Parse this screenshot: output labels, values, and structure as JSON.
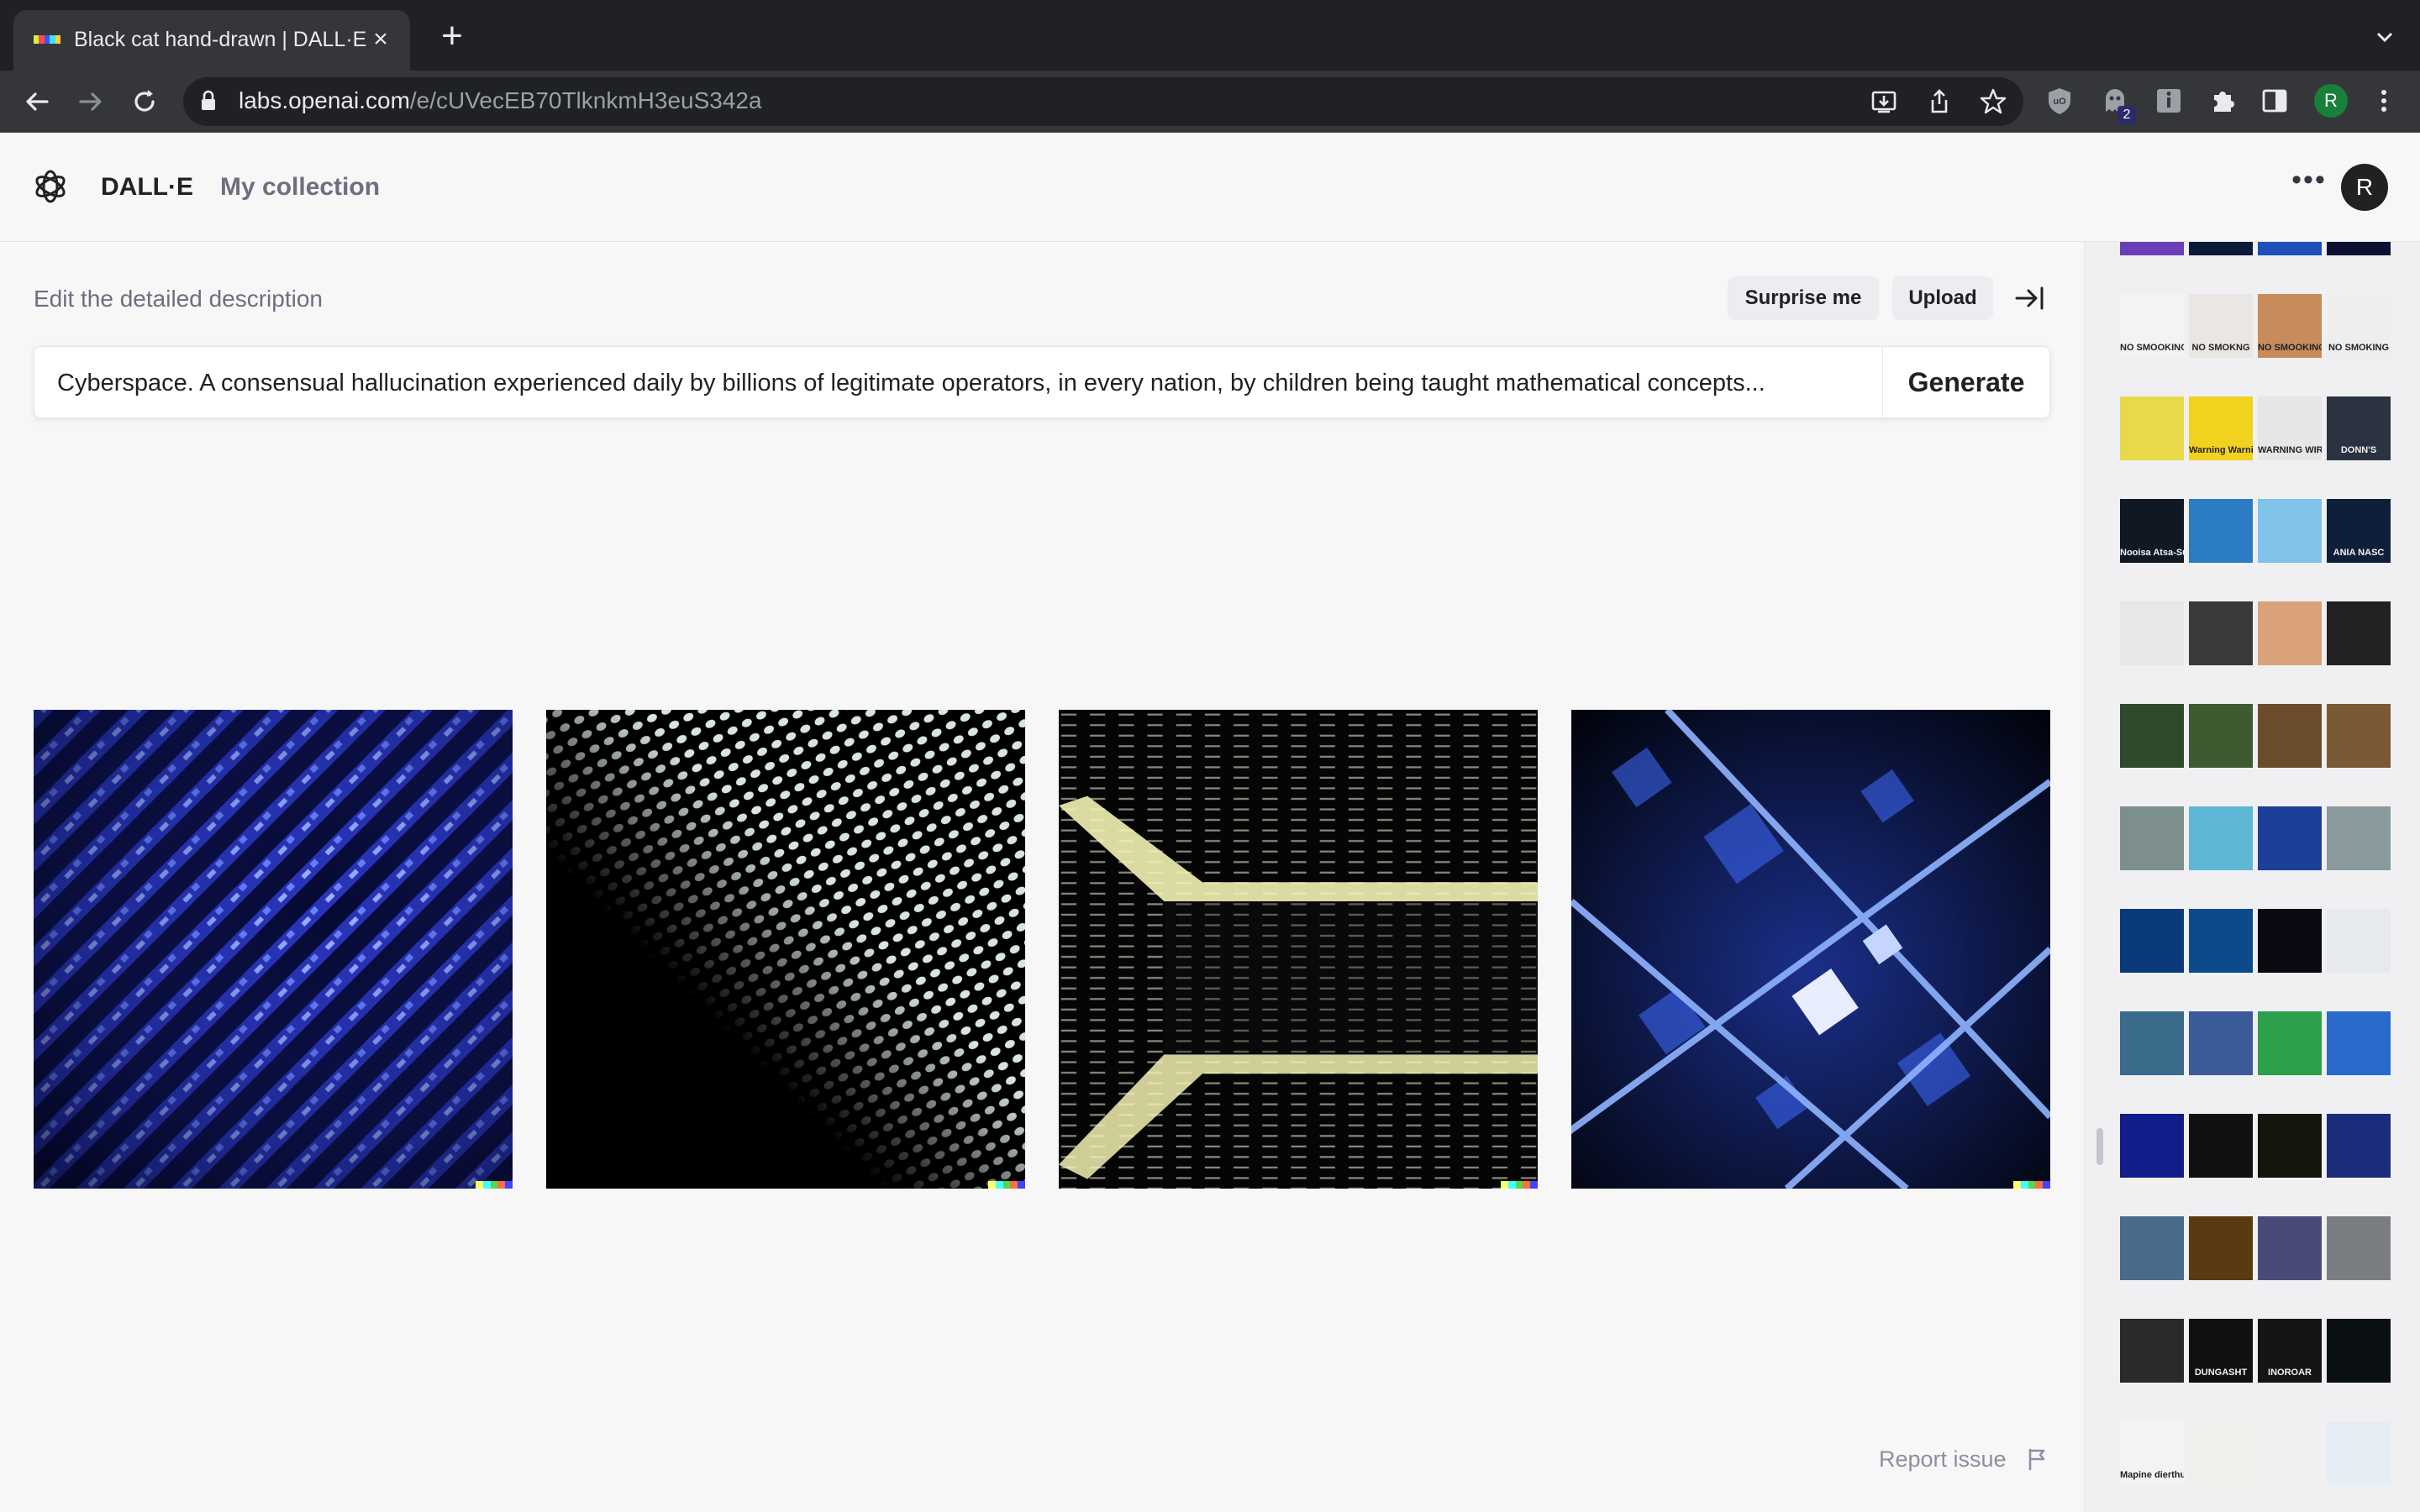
{
  "browser": {
    "tab_title": "Black cat hand-drawn | DALL·E",
    "url_host": "labs.openai.com",
    "url_path": "/e/cUVecEB70TlknkmH3euS342a",
    "profile_initial": "R",
    "extension_badge": "2",
    "favicon_colors": [
      "#d5f04a",
      "#ff4b4b",
      "#3f51ff",
      "#3ee3ff",
      "#ffcf3f"
    ]
  },
  "app": {
    "brand": "DALL·E",
    "nav_collection": "My collection",
    "avatar_initial": "R",
    "menu_icon": "more-horizontal-icon"
  },
  "editor": {
    "label": "Edit the detailed description",
    "surprise_label": "Surprise me",
    "upload_label": "Upload",
    "prompt": "Cyberspace. A consensual hallucination experienced daily by billions of legitimate operators, in every nation, by children being taught mathematical concepts...",
    "generate_label": "Generate"
  },
  "results": {
    "images": [
      {
        "style": "blue-diagonal-circuit",
        "dominant": "#1a2a9c"
      },
      {
        "style": "white-dot-matrix",
        "dominant": "#cfd8dc"
      },
      {
        "style": "gold-data-corridor",
        "dominant": "#e6e39b"
      },
      {
        "style": "blue-city-grid",
        "dominant": "#3d63ff"
      }
    ],
    "signature_colors": [
      "#ffff66",
      "#42ffff",
      "#51da4c",
      "#ff6e3c",
      "#3c46ff"
    ]
  },
  "footer": {
    "report_label": "Report issue"
  },
  "history": {
    "rows": [
      [
        {
          "bg": "#6a3fb6",
          "caption": ""
        },
        {
          "bg": "#0b1a3a",
          "caption": ""
        },
        {
          "bg": "#1d4fb8",
          "caption": ""
        },
        {
          "bg": "#0d1030",
          "caption": ""
        }
      ],
      [
        {
          "bg": "#f3f3f3",
          "caption": "NO SMOOKING"
        },
        {
          "bg": "#e9e6e3",
          "caption": "NO SMOKNG"
        },
        {
          "bg": "#c88c5c",
          "caption": "NO SMOOKING"
        },
        {
          "bg": "#efeeee",
          "caption": "NO SMOKING"
        }
      ],
      [
        {
          "bg": "#e8d94a",
          "caption": ""
        },
        {
          "bg": "#f1d21f",
          "caption": "Warning Warning"
        },
        {
          "bg": "#e6e6e6",
          "caption": "WARNING WIRE"
        },
        {
          "bg": "#2b3340",
          "caption": "DONN'S"
        }
      ],
      [
        {
          "bg": "#101824",
          "caption": "Nooisa Atsa-Supicia"
        },
        {
          "bg": "#2c7cc4",
          "caption": ""
        },
        {
          "bg": "#7fc3e8",
          "caption": ""
        },
        {
          "bg": "#0f1f3a",
          "caption": "ANIA NASC"
        }
      ],
      [
        {
          "bg": "#e7e7e7",
          "caption": ""
        },
        {
          "bg": "#3a3a3a",
          "caption": ""
        },
        {
          "bg": "#d9a27a",
          "caption": ""
        },
        {
          "bg": "#222",
          "caption": ""
        }
      ],
      [
        {
          "bg": "#2e4a2a",
          "caption": ""
        },
        {
          "bg": "#3d5a30",
          "caption": ""
        },
        {
          "bg": "#6c4d2b",
          "caption": ""
        },
        {
          "bg": "#7a5a34",
          "caption": ""
        }
      ],
      [
        {
          "bg": "#7c8f8c",
          "caption": ""
        },
        {
          "bg": "#5fb7d6",
          "caption": ""
        },
        {
          "bg": "#1c3f9a",
          "caption": ""
        },
        {
          "bg": "#8a9a9c",
          "caption": ""
        }
      ],
      [
        {
          "bg": "#0a3a7a",
          "caption": ""
        },
        {
          "bg": "#0c4a8a",
          "caption": ""
        },
        {
          "bg": "#0a0a12",
          "caption": ""
        },
        {
          "bg": "#e6e9ee",
          "caption": ""
        }
      ],
      [
        {
          "bg": "#3a6b8a",
          "caption": ""
        },
        {
          "bg": "#3a5a9a",
          "caption": ""
        },
        {
          "bg": "#2ca04a",
          "caption": ""
        },
        {
          "bg": "#2a6acc",
          "caption": ""
        }
      ],
      [
        {
          "bg": "#121c8a",
          "caption": ""
        },
        {
          "bg": "#101010",
          "caption": ""
        },
        {
          "bg": "#15150c",
          "caption": ""
        },
        {
          "bg": "#1a2c7a",
          "caption": ""
        }
      ],
      [
        {
          "bg": "#4a6a8a",
          "caption": ""
        },
        {
          "bg": "#5a3a10",
          "caption": ""
        },
        {
          "bg": "#4a4a7a",
          "caption": ""
        },
        {
          "bg": "#7a7e82",
          "caption": ""
        }
      ],
      [
        {
          "bg": "#2a2a2a",
          "caption": ""
        },
        {
          "bg": "#111",
          "caption": "DUNGASHT"
        },
        {
          "bg": "#151515",
          "caption": "INOROAR"
        },
        {
          "bg": "#0a0f14",
          "caption": ""
        }
      ],
      [
        {
          "bg": "#f3f3f3",
          "caption": "Mapine dierthuta"
        },
        {
          "bg": "#f0efe9",
          "caption": ""
        },
        {
          "bg": "#eef0f2",
          "caption": ""
        },
        {
          "bg": "#e6edf4",
          "caption": ""
        }
      ]
    ]
  }
}
